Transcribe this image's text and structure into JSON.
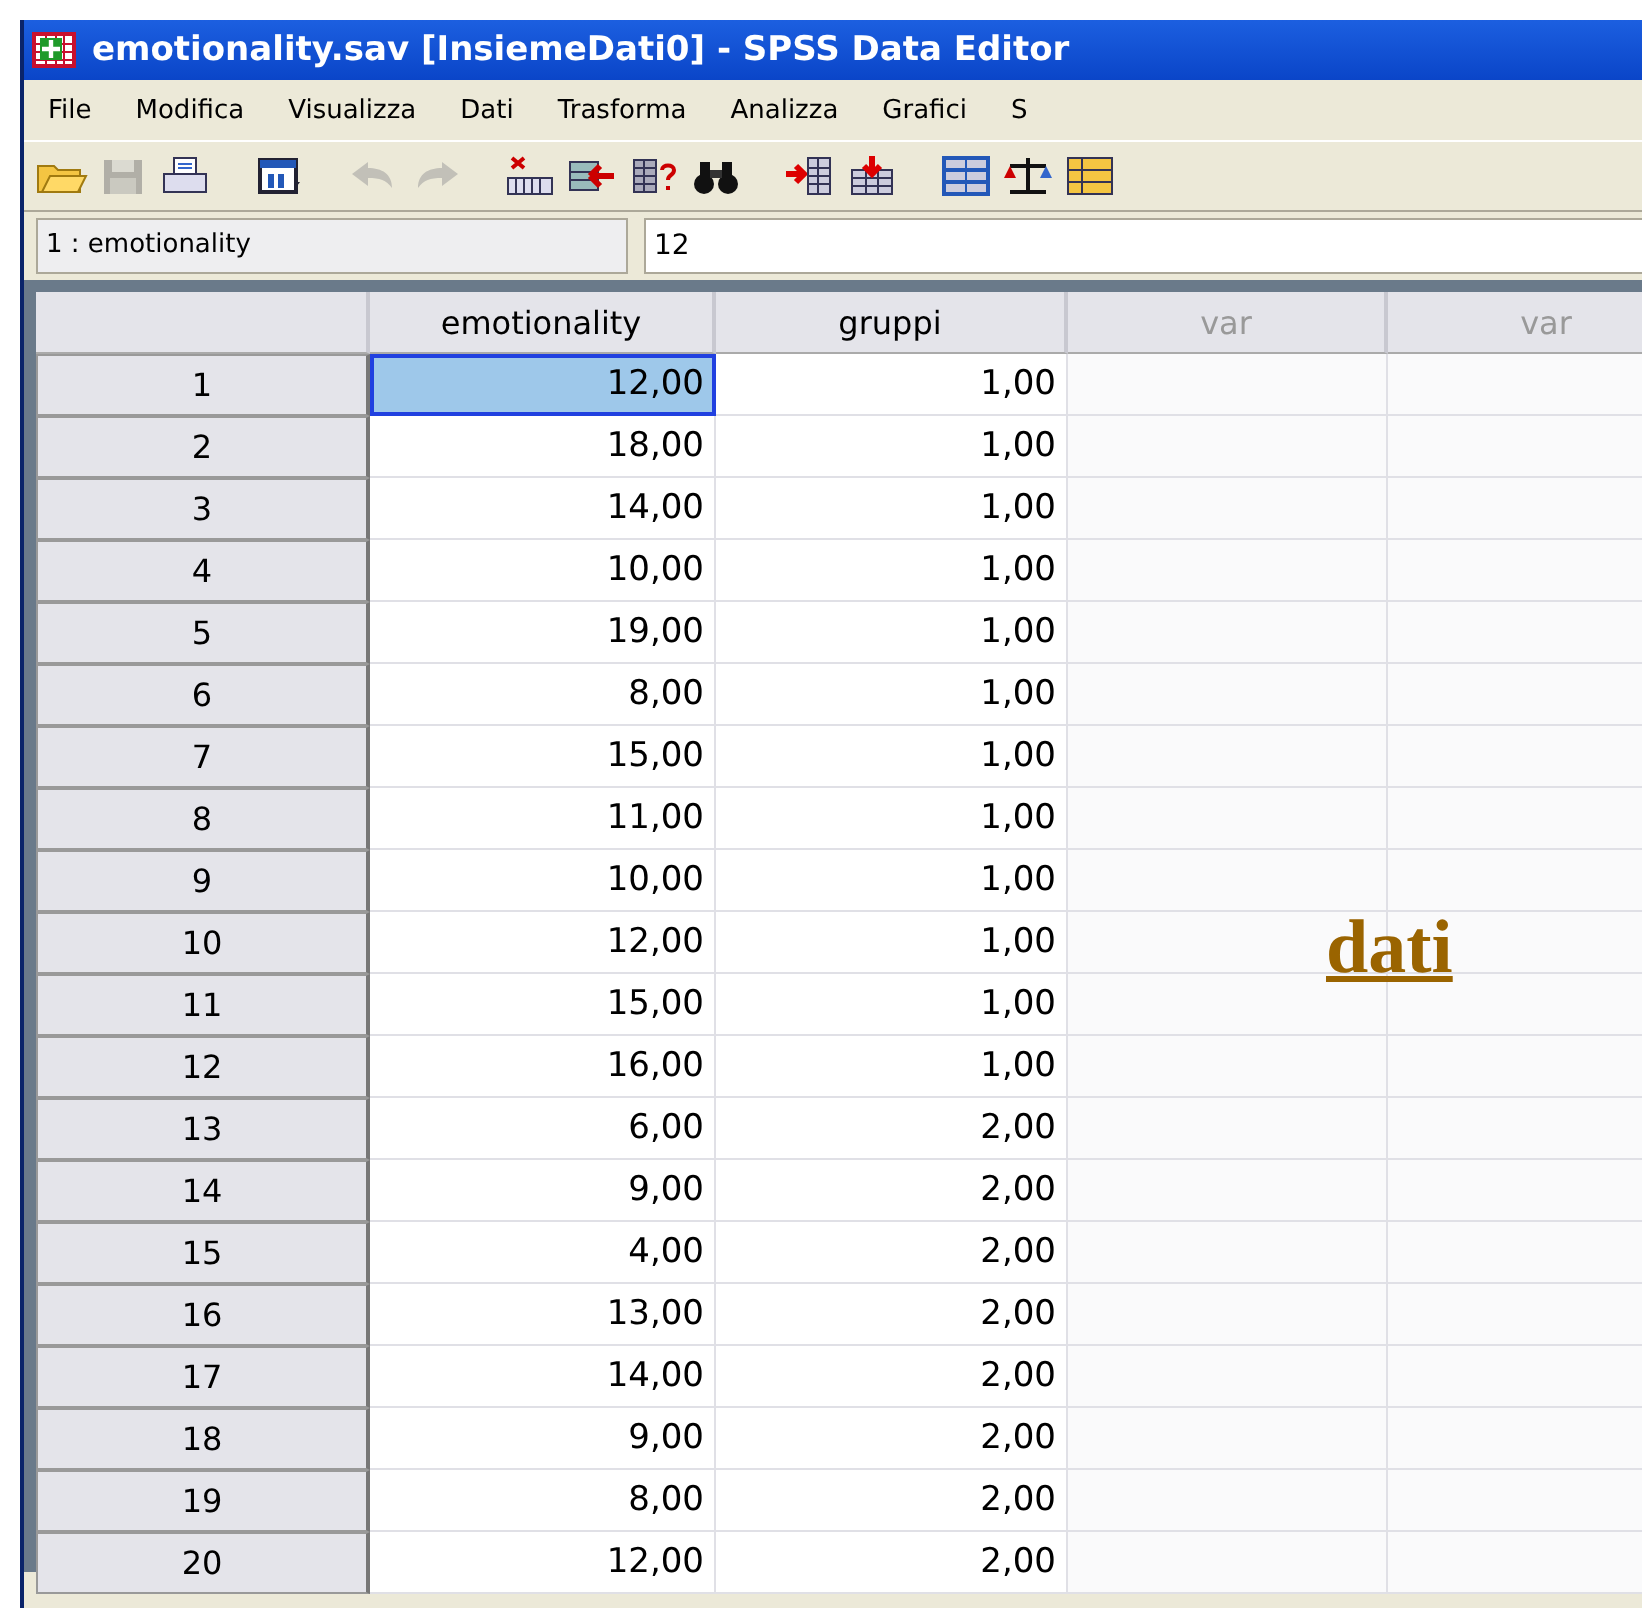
{
  "window": {
    "title": "emotionality.sav [InsiemeDati0] - SPSS Data Editor"
  },
  "menu": [
    "File",
    "Modifica",
    "Visualizza",
    "Dati",
    "Trasforma",
    "Analizza",
    "Grafici",
    "S"
  ],
  "toolbar": [
    {
      "kind": "open",
      "disabled": false
    },
    {
      "kind": "save",
      "disabled": true
    },
    {
      "kind": "print",
      "disabled": false
    },
    {
      "kind": "dialog",
      "disabled": false
    },
    {
      "kind": "undo",
      "disabled": true
    },
    {
      "kind": "redo",
      "disabled": true
    },
    {
      "kind": "goto",
      "disabled": false
    },
    {
      "kind": "variables",
      "disabled": false
    },
    {
      "kind": "info",
      "disabled": false
    },
    {
      "kind": "find",
      "disabled": false
    },
    {
      "kind": "insert_case",
      "disabled": false
    },
    {
      "kind": "insert_var",
      "disabled": false
    },
    {
      "kind": "split",
      "disabled": false
    },
    {
      "kind": "weight",
      "disabled": false
    },
    {
      "kind": "select",
      "disabled": false
    }
  ],
  "cell_ref": {
    "name": "1 : emotionality",
    "value": "12"
  },
  "columns": [
    {
      "label": "emotionality",
      "kind": "variable"
    },
    {
      "label": "gruppi",
      "kind": "variable"
    },
    {
      "label": "var",
      "kind": "empty"
    },
    {
      "label": "var",
      "kind": "empty"
    }
  ],
  "rows": [
    {
      "number": "1",
      "cells": [
        {
          "value": "12,00",
          "selected": true
        },
        {
          "value": "1,00",
          "selected": false
        }
      ]
    },
    {
      "number": "2",
      "cells": [
        {
          "value": "18,00",
          "selected": false
        },
        {
          "value": "1,00",
          "selected": false
        }
      ]
    },
    {
      "number": "3",
      "cells": [
        {
          "value": "14,00",
          "selected": false
        },
        {
          "value": "1,00",
          "selected": false
        }
      ]
    },
    {
      "number": "4",
      "cells": [
        {
          "value": "10,00",
          "selected": false
        },
        {
          "value": "1,00",
          "selected": false
        }
      ]
    },
    {
      "number": "5",
      "cells": [
        {
          "value": "19,00",
          "selected": false
        },
        {
          "value": "1,00",
          "selected": false
        }
      ]
    },
    {
      "number": "6",
      "cells": [
        {
          "value": "8,00",
          "selected": false
        },
        {
          "value": "1,00",
          "selected": false
        }
      ]
    },
    {
      "number": "7",
      "cells": [
        {
          "value": "15,00",
          "selected": false
        },
        {
          "value": "1,00",
          "selected": false
        }
      ]
    },
    {
      "number": "8",
      "cells": [
        {
          "value": "11,00",
          "selected": false
        },
        {
          "value": "1,00",
          "selected": false
        }
      ]
    },
    {
      "number": "9",
      "cells": [
        {
          "value": "10,00",
          "selected": false
        },
        {
          "value": "1,00",
          "selected": false
        }
      ]
    },
    {
      "number": "10",
      "cells": [
        {
          "value": "12,00",
          "selected": false
        },
        {
          "value": "1,00",
          "selected": false
        }
      ]
    },
    {
      "number": "11",
      "cells": [
        {
          "value": "15,00",
          "selected": false
        },
        {
          "value": "1,00",
          "selected": false
        }
      ]
    },
    {
      "number": "12",
      "cells": [
        {
          "value": "16,00",
          "selected": false
        },
        {
          "value": "1,00",
          "selected": false
        }
      ]
    },
    {
      "number": "13",
      "cells": [
        {
          "value": "6,00",
          "selected": false
        },
        {
          "value": "2,00",
          "selected": false
        }
      ]
    },
    {
      "number": "14",
      "cells": [
        {
          "value": "9,00",
          "selected": false
        },
        {
          "value": "2,00",
          "selected": false
        }
      ]
    },
    {
      "number": "15",
      "cells": [
        {
          "value": "4,00",
          "selected": false
        },
        {
          "value": "2,00",
          "selected": false
        }
      ]
    },
    {
      "number": "16",
      "cells": [
        {
          "value": "13,00",
          "selected": false
        },
        {
          "value": "2,00",
          "selected": false
        }
      ]
    },
    {
      "number": "17",
      "cells": [
        {
          "value": "14,00",
          "selected": false
        },
        {
          "value": "2,00",
          "selected": false
        }
      ]
    },
    {
      "number": "18",
      "cells": [
        {
          "value": "9,00",
          "selected": false
        },
        {
          "value": "2,00",
          "selected": false
        }
      ]
    },
    {
      "number": "19",
      "cells": [
        {
          "value": "8,00",
          "selected": false
        },
        {
          "value": "2,00",
          "selected": false
        }
      ]
    },
    {
      "number": "20",
      "cells": [
        {
          "value": "12,00",
          "selected": false
        },
        {
          "value": "2,00",
          "selected": false
        }
      ]
    }
  ],
  "overlay_link": "dati"
}
